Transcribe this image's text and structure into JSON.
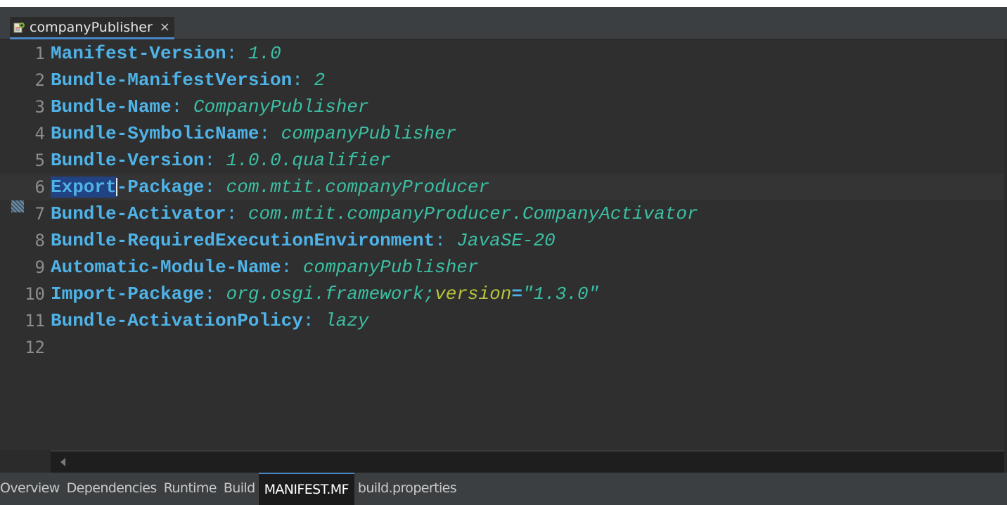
{
  "editor_tab": {
    "title": "companyPublisher",
    "close_symbol": "×",
    "icon": "plugin-manifest-icon"
  },
  "lines": [
    {
      "num": "1",
      "key": "Manifest-Version",
      "value": "1.0"
    },
    {
      "num": "2",
      "key": "Bundle-ManifestVersion",
      "value": "2"
    },
    {
      "num": "3",
      "key": "Bundle-Name",
      "value": "CompanyPublisher"
    },
    {
      "num": "4",
      "key": "Bundle-SymbolicName",
      "value": "companyPublisher"
    },
    {
      "num": "5",
      "key": "Bundle-Version",
      "value": "1.0.0.qualifier"
    },
    {
      "num": "6",
      "key_selected": "Export",
      "key_rest": "-Package",
      "value": "com.mtit.companyProducer"
    },
    {
      "num": "7",
      "key": "Bundle-Activator",
      "value": "com.mtit.companyProducer.CompanyActivator"
    },
    {
      "num": "8",
      "key": "Bundle-RequiredExecutionEnvironment",
      "value": "JavaSE-20"
    },
    {
      "num": "9",
      "key": "Automatic-Module-Name",
      "value": "companyPublisher"
    },
    {
      "num": "10",
      "key": "Import-Package",
      "value": "org.osgi.framework;",
      "attr": "version",
      "eq": "=",
      "attr_value": "\"1.3.0\""
    },
    {
      "num": "11",
      "key": "Bundle-ActivationPolicy",
      "value": "lazy"
    },
    {
      "num": "12"
    }
  ],
  "colon": ": ",
  "bottom_tabs": [
    "Overview",
    "Dependencies",
    "Runtime",
    "Build",
    "MANIFEST.MF",
    "build.properties"
  ],
  "active_bottom_tab": "MANIFEST.MF",
  "colors": {
    "key": "#4fb3e8",
    "value": "#3bbfa4",
    "attr": "#b8c43a",
    "selection": "#214283",
    "background": "#2f2f2f"
  }
}
